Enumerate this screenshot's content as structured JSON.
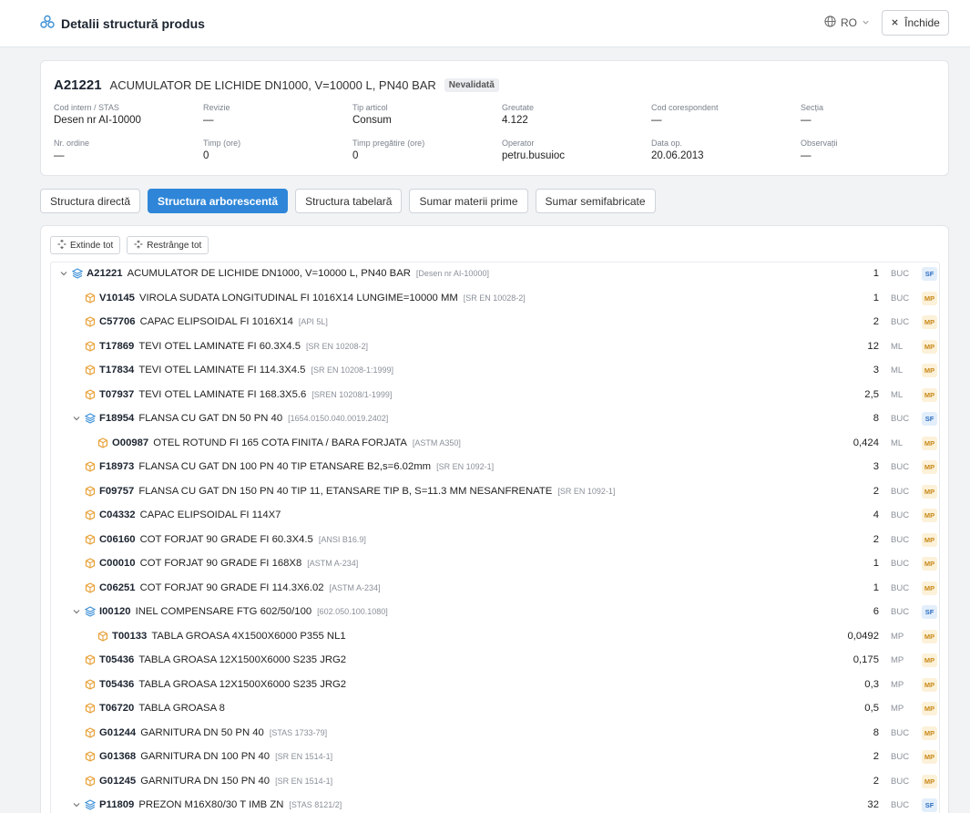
{
  "header": {
    "title": "Detalii structură produs",
    "lang": "RO",
    "close_label": "Închide"
  },
  "product": {
    "code": "A21221",
    "name": "ACUMULATOR DE LICHIDE DN1000, V=10000 L, PN40 BAR",
    "status": "Nevalidată",
    "fields": [
      {
        "label": "Cod intern / STAS",
        "value": "Desen nr AI-10000"
      },
      {
        "label": "Revizie",
        "value": "—"
      },
      {
        "label": "Tip articol",
        "value": "Consum"
      },
      {
        "label": "Greutate",
        "value": "4.122"
      },
      {
        "label": "Cod corespondent",
        "value": "—"
      },
      {
        "label": "Secția",
        "value": "—"
      },
      {
        "label": "Nr. ordine",
        "value": "—"
      },
      {
        "label": "Timp (ore)",
        "value": "0"
      },
      {
        "label": "Timp pregătire (ore)",
        "value": "0"
      },
      {
        "label": "Operator",
        "value": "petru.busuioc"
      },
      {
        "label": "Data op.",
        "value": "20.06.2013"
      },
      {
        "label": "Observații",
        "value": "—"
      }
    ]
  },
  "tabs": [
    {
      "label": "Structura directă",
      "active": false
    },
    {
      "label": "Structura arborescentă",
      "active": true
    },
    {
      "label": "Structura tabelară",
      "active": false
    },
    {
      "label": "Sumar materii prime",
      "active": false
    },
    {
      "label": "Sumar semifabricate",
      "active": false
    }
  ],
  "tree_tools": {
    "expand_label": "Extinde tot",
    "collapse_label": "Restrânge tot"
  },
  "tree_rows": [
    {
      "level": 0,
      "type": "SF",
      "expanded": true,
      "code": "A21221",
      "name": "ACUMULATOR DE LICHIDE DN1000, V=10000 L, PN40 BAR",
      "std": "[Desen nr AI-10000]",
      "qty": "1",
      "unit": "BUC"
    },
    {
      "level": 1,
      "type": "MP",
      "code": "V10145",
      "name": "VIROLA SUDATA LONGITUDINAL FI 1016X14 LUNGIME=10000 MM",
      "std": "[SR EN 10028-2]",
      "qty": "1",
      "unit": "BUC"
    },
    {
      "level": 1,
      "type": "MP",
      "code": "C57706",
      "name": "CAPAC ELIPSOIDAL FI 1016X14",
      "std": "[API 5L]",
      "qty": "2",
      "unit": "BUC"
    },
    {
      "level": 1,
      "type": "MP",
      "code": "T17869",
      "name": "TEVI OTEL LAMINATE FI 60.3X4.5",
      "std": "[SR EN 10208-2]",
      "qty": "12",
      "unit": "ML"
    },
    {
      "level": 1,
      "type": "MP",
      "code": "T17834",
      "name": "TEVI OTEL LAMINATE FI 114.3X4.5",
      "std": "[SR EN 10208-1:1999]",
      "qty": "3",
      "unit": "ML"
    },
    {
      "level": 1,
      "type": "MP",
      "code": "T07937",
      "name": "TEVI OTEL LAMINATE FI 168.3X5.6",
      "std": "[SREN 10208/1-1999]",
      "qty": "2,5",
      "unit": "ML"
    },
    {
      "level": 1,
      "type": "SF",
      "expanded": true,
      "code": "F18954",
      "name": "FLANSA CU GAT DN 50 PN 40",
      "std": "[1654.0150.040.0019.2402]",
      "qty": "8",
      "unit": "BUC"
    },
    {
      "level": 2,
      "type": "MP",
      "code": "O00987",
      "name": "OTEL ROTUND FI 165 COTA FINITA / BARA FORJATA",
      "std": "[ASTM A350]",
      "qty": "0,424",
      "unit": "ML"
    },
    {
      "level": 1,
      "type": "MP",
      "code": "F18973",
      "name": "FLANSA CU GAT DN 100 PN 40 TIP ETANSARE B2,s=6.02mm",
      "std": "[SR EN 1092-1]",
      "qty": "3",
      "unit": "BUC"
    },
    {
      "level": 1,
      "type": "MP",
      "code": "F09757",
      "name": "FLANSA CU GAT DN 150 PN 40 TIP 11, ETANSARE TIP B, S=11.3 MM NESANFRENATE",
      "std": "[SR EN 1092-1]",
      "qty": "2",
      "unit": "BUC"
    },
    {
      "level": 1,
      "type": "MP",
      "code": "C04332",
      "name": "CAPAC ELIPSOIDAL FI 114X7",
      "std": "",
      "qty": "4",
      "unit": "BUC"
    },
    {
      "level": 1,
      "type": "MP",
      "code": "C06160",
      "name": "COT FORJAT 90 GRADE FI 60.3X4.5",
      "std": "[ANSI B16.9]",
      "qty": "2",
      "unit": "BUC"
    },
    {
      "level": 1,
      "type": "MP",
      "code": "C00010",
      "name": "COT FORJAT 90 GRADE FI 168X8",
      "std": "[ASTM A-234]",
      "qty": "1",
      "unit": "BUC"
    },
    {
      "level": 1,
      "type": "MP",
      "code": "C06251",
      "name": "COT FORJAT 90 GRADE FI 114.3X6.02",
      "std": "[ASTM A-234]",
      "qty": "1",
      "unit": "BUC"
    },
    {
      "level": 1,
      "type": "SF",
      "expanded": true,
      "code": "I00120",
      "name": "INEL COMPENSARE FTG 602/50/100",
      "std": "[602.050.100.1080]",
      "qty": "6",
      "unit": "BUC"
    },
    {
      "level": 2,
      "type": "MP",
      "code": "T00133",
      "name": "TABLA GROASA 4X1500X6000 P355 NL1",
      "std": "",
      "qty": "0,0492",
      "unit": "MP"
    },
    {
      "level": 1,
      "type": "MP",
      "code": "T05436",
      "name": "TABLA GROASA 12X1500X6000 S235 JRG2",
      "std": "",
      "qty": "0,175",
      "unit": "MP"
    },
    {
      "level": 1,
      "type": "MP",
      "code": "T05436",
      "name": "TABLA GROASA 12X1500X6000 S235 JRG2",
      "std": "",
      "qty": "0,3",
      "unit": "MP"
    },
    {
      "level": 1,
      "type": "MP",
      "code": "T06720",
      "name": "TABLA GROASA 8",
      "std": "",
      "qty": "0,5",
      "unit": "MP"
    },
    {
      "level": 1,
      "type": "MP",
      "code": "G01244",
      "name": "GARNITURA DN 50 PN 40",
      "std": "[STAS 1733-79]",
      "qty": "8",
      "unit": "BUC"
    },
    {
      "level": 1,
      "type": "MP",
      "code": "G01368",
      "name": "GARNITURA DN 100 PN 40",
      "std": "[SR EN 1514-1]",
      "qty": "2",
      "unit": "BUC"
    },
    {
      "level": 1,
      "type": "MP",
      "code": "G01245",
      "name": "GARNITURA DN 150 PN 40",
      "std": "[SR EN 1514-1]",
      "qty": "2",
      "unit": "BUC"
    },
    {
      "level": 1,
      "type": "SF",
      "expanded": true,
      "code": "P11809",
      "name": "PREZON M16X80/30 T IMB ZN",
      "std": "[STAS 8121/2]",
      "qty": "32",
      "unit": "BUC"
    }
  ],
  "colors": {
    "accent": "#2f86d8",
    "mp_icon": "#e8a23a",
    "sf_icon": "#3b8fd6"
  },
  "icons": {
    "brand": "structure-icon",
    "lang": "globe-icon",
    "close": "close-icon",
    "expand": "expand-icon",
    "collapse": "collapse-icon",
    "mp": "box-icon",
    "sf": "layers-icon"
  }
}
